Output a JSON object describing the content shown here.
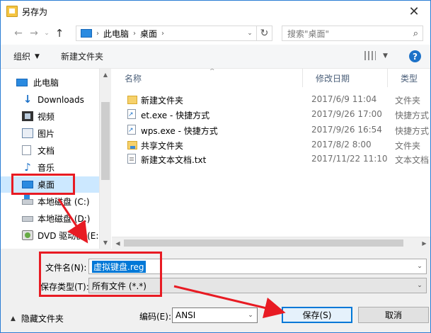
{
  "window": {
    "title": "另存为",
    "close_glyph": "✕"
  },
  "address": {
    "crumbs": [
      "此电脑",
      "桌面"
    ],
    "search_placeholder": "搜索\"桌面\""
  },
  "toolbar": {
    "organize_label": "组织",
    "new_folder_label": "新建文件夹"
  },
  "sidebar": {
    "items": [
      {
        "label": "此电脑",
        "icon": "pc-icon"
      },
      {
        "label": "Downloads",
        "icon": "download-icon"
      },
      {
        "label": "视频",
        "icon": "video-icon"
      },
      {
        "label": "图片",
        "icon": "picture-icon"
      },
      {
        "label": "文档",
        "icon": "document-icon"
      },
      {
        "label": "音乐",
        "icon": "music-icon"
      },
      {
        "label": "桌面",
        "icon": "desktop-icon",
        "selected": true
      },
      {
        "label": "本地磁盘 (C:)",
        "icon": "drive-icon"
      },
      {
        "label": "本地磁盘 (D:)",
        "icon": "drive-icon"
      },
      {
        "label": "DVD 驱动器 (E:)",
        "icon": "dvd-icon"
      }
    ]
  },
  "filelist": {
    "columns": [
      "名称",
      "修改日期",
      "类型"
    ],
    "rows": [
      {
        "name": "新建文件夹",
        "date": "2017/6/9 11:04",
        "type": "文件夹",
        "icon": "folder-icon"
      },
      {
        "name": "et.exe - 快捷方式",
        "date": "2017/9/26 17:00",
        "type": "快捷方式",
        "icon": "shortcut-icon"
      },
      {
        "name": "wps.exe - 快捷方式",
        "date": "2017/9/26 16:54",
        "type": "快捷方式",
        "icon": "shortcut-icon"
      },
      {
        "name": "共享文件夹",
        "date": "2017/8/2 8:00",
        "type": "文件夹",
        "icon": "shared-folder-icon"
      },
      {
        "name": "新建文本文档.txt",
        "date": "2017/11/22 11:10",
        "type": "文本文档",
        "icon": "text-file-icon"
      }
    ]
  },
  "form": {
    "filename_label": "文件名(N):",
    "filename_value": "虚拟键盘.reg",
    "savetype_label": "保存类型(T):",
    "savetype_value": "所有文件  (*.*)",
    "encoding_label": "编码(E):",
    "encoding_value": "ANSI",
    "hide_folders_label": "隐藏文件夹",
    "save_label": "保存(S)",
    "cancel_label": "取消"
  },
  "colors": {
    "accent": "#0078d7",
    "annotation": "#e81b23",
    "selection": "#cce8ff"
  }
}
